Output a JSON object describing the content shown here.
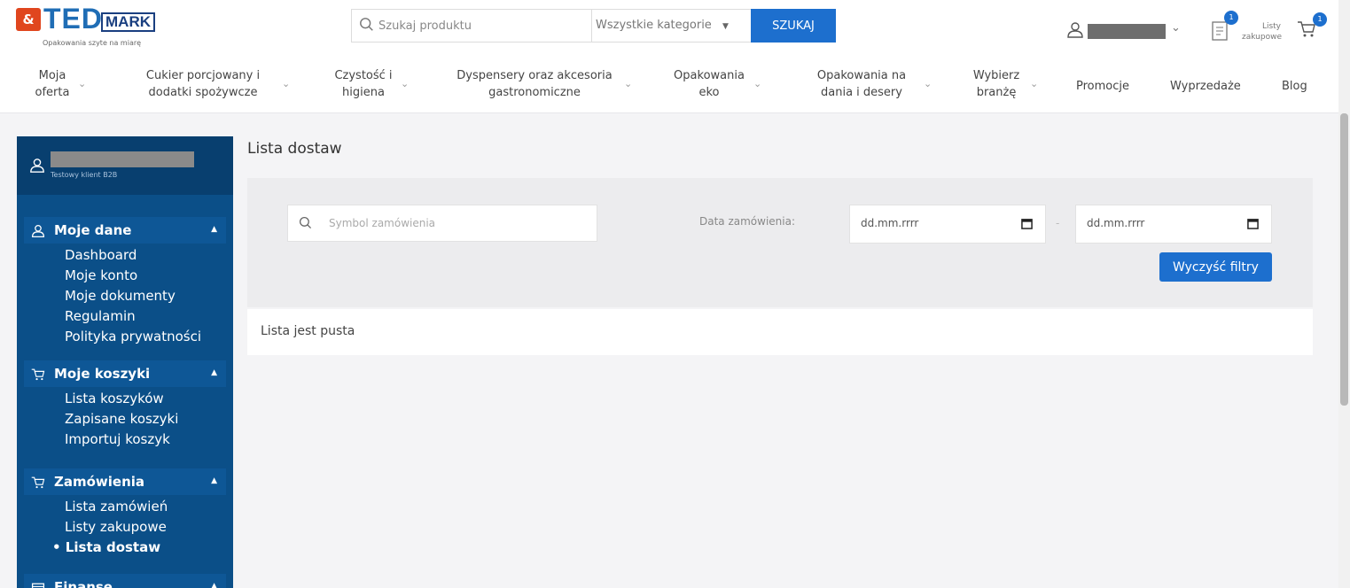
{
  "header": {
    "logo": {
      "brand_left": "TED",
      "brand_right": "MARK",
      "tagline": "Opakowania szyte na miarę"
    },
    "search": {
      "placeholder": "Szukaj produktu",
      "category": "Wszystkie kategorie",
      "button": "SZUKAJ"
    },
    "lists": {
      "label_line1": "Listy",
      "label_line2": "zakupowe",
      "badge": "1"
    },
    "cart": {
      "badge": "1"
    }
  },
  "nav": {
    "items": [
      {
        "line1": "Moja",
        "line2": "oferta"
      },
      {
        "line1": "Cukier porcjowany i",
        "line2": "dodatki spożywcze"
      },
      {
        "line1": "Czystość i",
        "line2": "higiena"
      },
      {
        "line1": "Dyspensery oraz akcesoria",
        "line2": "gastronomiczne"
      },
      {
        "line1": "Opakowania",
        "line2": "eko"
      },
      {
        "line1": "Opakowania na",
        "line2": "dania i desery"
      },
      {
        "line1": "Wybierz",
        "line2": "branżę"
      },
      {
        "line1": "Promocje"
      },
      {
        "line1": "Wyprzedaże"
      },
      {
        "line1": "Blog"
      }
    ]
  },
  "sidebar": {
    "user_role": "Testowy klient B2B",
    "sections": [
      {
        "label": "Moje dane",
        "links": [
          "Dashboard",
          "Moje konto",
          "Moje dokumenty",
          "Regulamin",
          "Polityka prywatności"
        ]
      },
      {
        "label": "Moje koszyki",
        "links": [
          "Lista koszyków",
          "Zapisane koszyki",
          "Importuj koszyk"
        ]
      },
      {
        "label": "Zamówienia",
        "links": [
          "Lista zamówień",
          "Listy zakupowe",
          "• Lista dostaw"
        ]
      },
      {
        "label": "Finanse",
        "links": []
      }
    ]
  },
  "main": {
    "title": "Lista dostaw",
    "filters": {
      "search_placeholder": "Symbol zamówienia",
      "date_label": "Data zamówienia:",
      "date_from": "dd.mm.rrrr",
      "date_to": "dd.mm.rrrr",
      "date_separator": "-",
      "clear_button": "Wyczyść filtry"
    },
    "empty_message": "Lista jest pusta"
  },
  "colors": {
    "primary": "#1d6fce",
    "sidebar": "#0b4f88",
    "sidebar_dark": "#083f6f",
    "logo_red": "#e0461e"
  }
}
